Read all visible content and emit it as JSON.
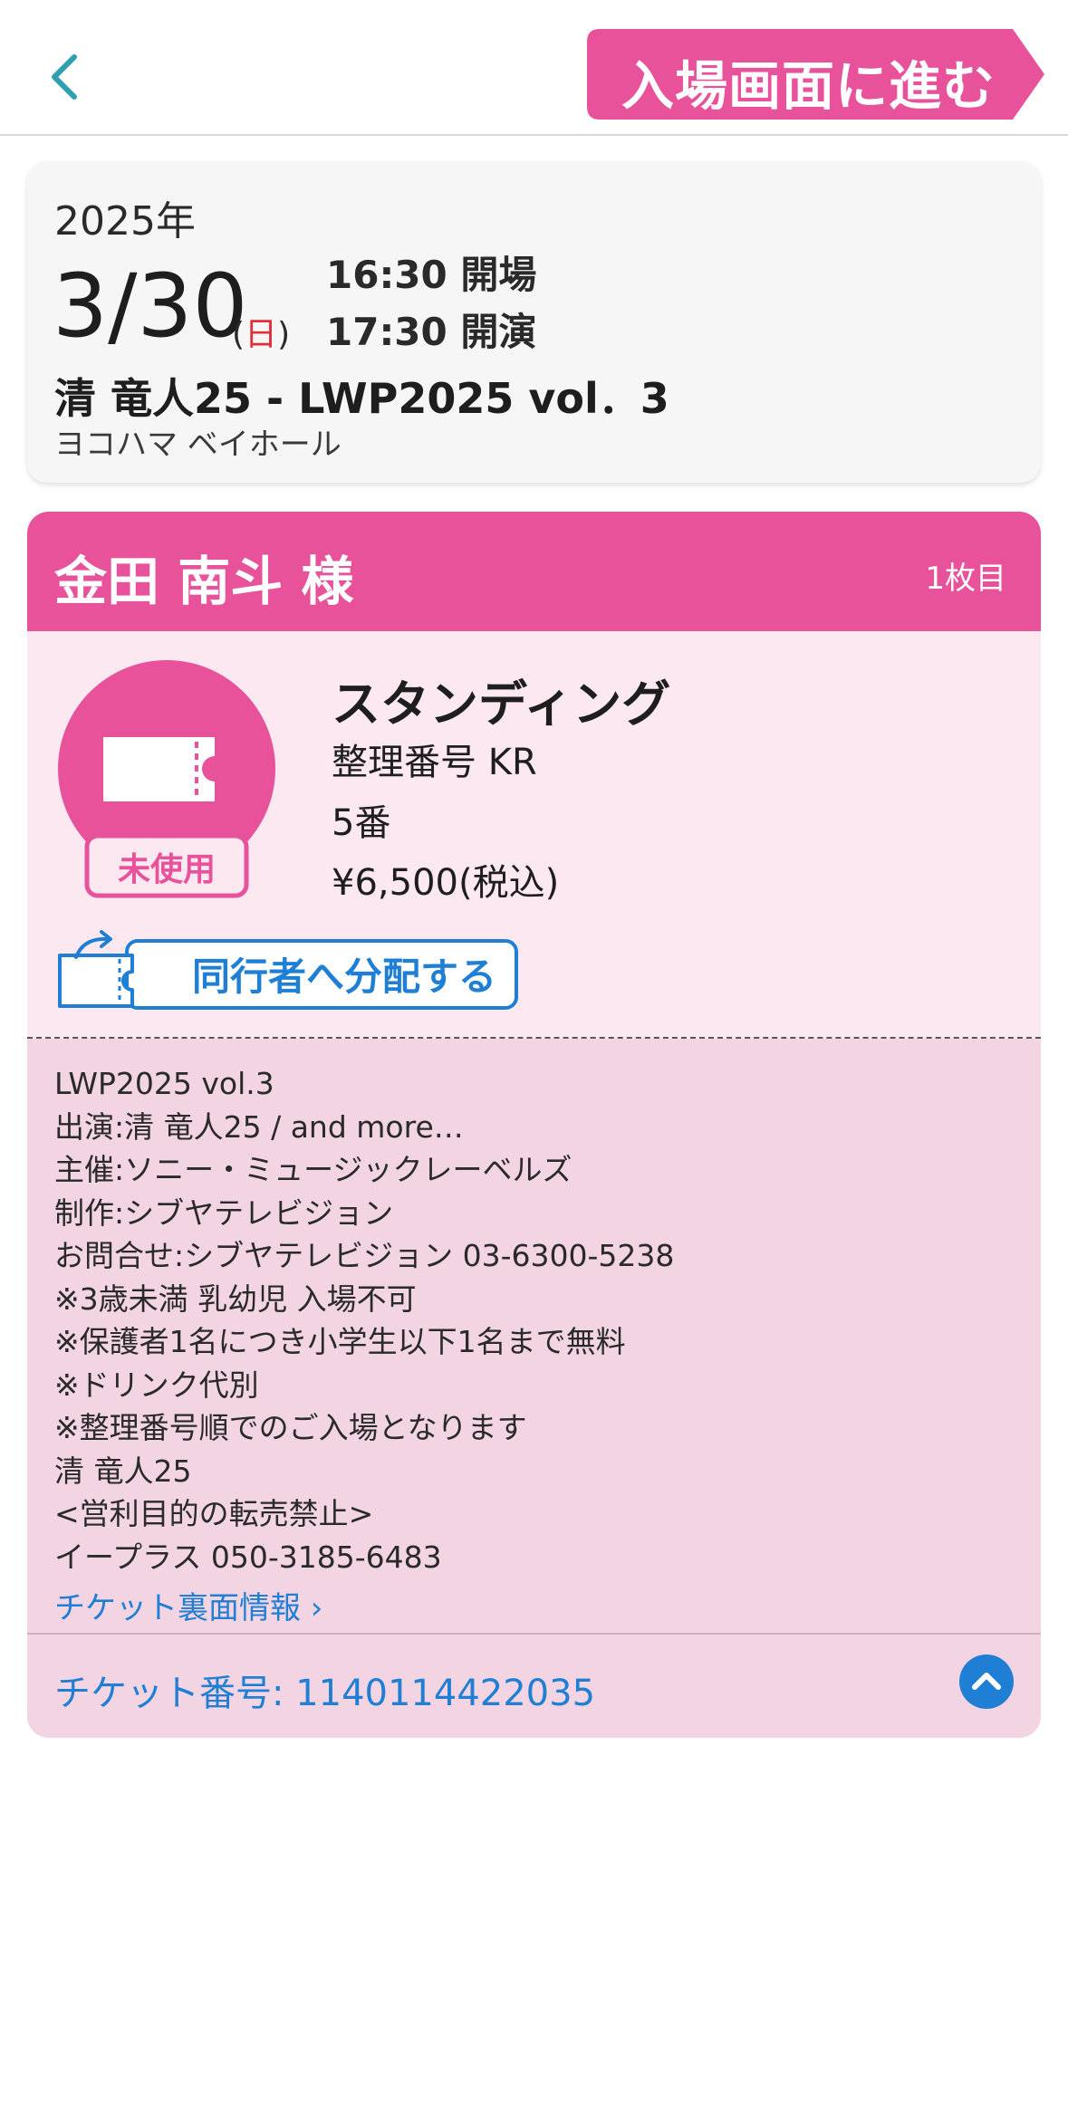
{
  "header": {
    "back_icon": "chevron-left-icon",
    "enter_label": "入場画面に進む",
    "enter_color": "#e8529a",
    "accent_color": "#2fa0b2"
  },
  "event": {
    "year": "2025年",
    "date": "3/30",
    "weekday_open": "(",
    "weekday": "日",
    "weekday_close": ")",
    "doors": "16:30 開場",
    "start": "17:30 開演",
    "title": "清 竜人25 - LWP2025 vol．3",
    "venue": "ヨコハマ ベイホール"
  },
  "ticket": {
    "holder": "金田 南斗 様",
    "count": "1枚目",
    "status": "未使用",
    "seat_type": "スタンディング",
    "ref_label": "整理番号 KR",
    "number": "5番",
    "price": "¥6,500(税込)",
    "share_label": "同行者へ分配する",
    "notes": [
      "LWP2025 vol.3",
      "出演:清 竜人25 / and more…",
      "主催:ソニー・ミュージックレーベルズ",
      "制作:シブヤテレビジョン",
      "お問合せ:シブヤテレビジョン 03-6300-5238",
      "※3歳未満 乳幼児 入場不可",
      "※保護者1名につき小学生以下1名まで無料",
      "※ドリンク代別",
      "※整理番号順でのご入場となります",
      "清 竜人25",
      "<営利目的の転売禁止>",
      "イープラス 050-3185-6483"
    ],
    "back_info_link": "チケット裏面情報 ›",
    "ticket_number": "チケット番号: 1140114422035",
    "head_color": "#e8529a",
    "link_color": "#1f7fd4"
  }
}
